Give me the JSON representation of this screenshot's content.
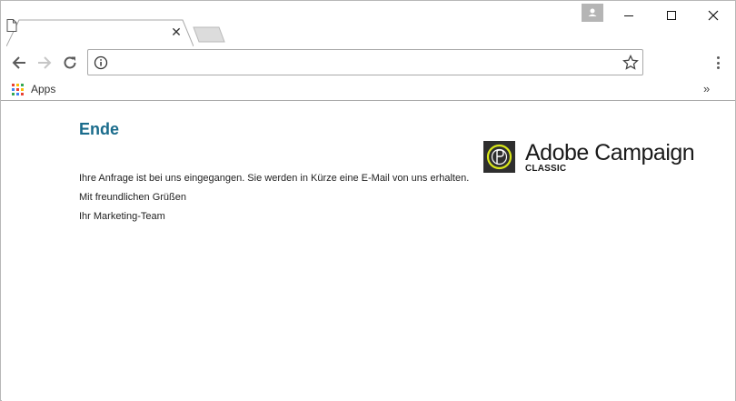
{
  "browser": {
    "tab": {
      "title": "",
      "close_glyph": "✕"
    },
    "window_controls": {
      "minimize": "minimize",
      "maximize": "maximize",
      "close": "close"
    },
    "address_bar": {
      "url": ""
    },
    "bookmarks": {
      "apps_label": "Apps",
      "overflow_glyph": "»"
    }
  },
  "icons": {
    "tab": "file-icon",
    "profile": "person-icon",
    "back": "arrow-left-icon",
    "forward": "arrow-right-icon",
    "reload": "reload-icon",
    "info": "info-icon",
    "bookmark": "star-icon",
    "menu": "kebab-menu-icon",
    "apps": "apps-grid-icon"
  },
  "page": {
    "heading": "Ende",
    "logo": {
      "name": "Adobe Campaign",
      "edition": "CLASSIC"
    },
    "paragraphs": [
      "Ihre Anfrage ist bei uns eingegangen. Sie werden in Kürze eine E-Mail von uns erhalten.",
      "Mit freundlichen Grüßen",
      "Ihr Marketing-Team"
    ]
  },
  "colors": {
    "heading": "#1a6c8c",
    "logo_mark_bg": "#2e2e2e",
    "logo_mark_accent": "#d8e61a"
  }
}
